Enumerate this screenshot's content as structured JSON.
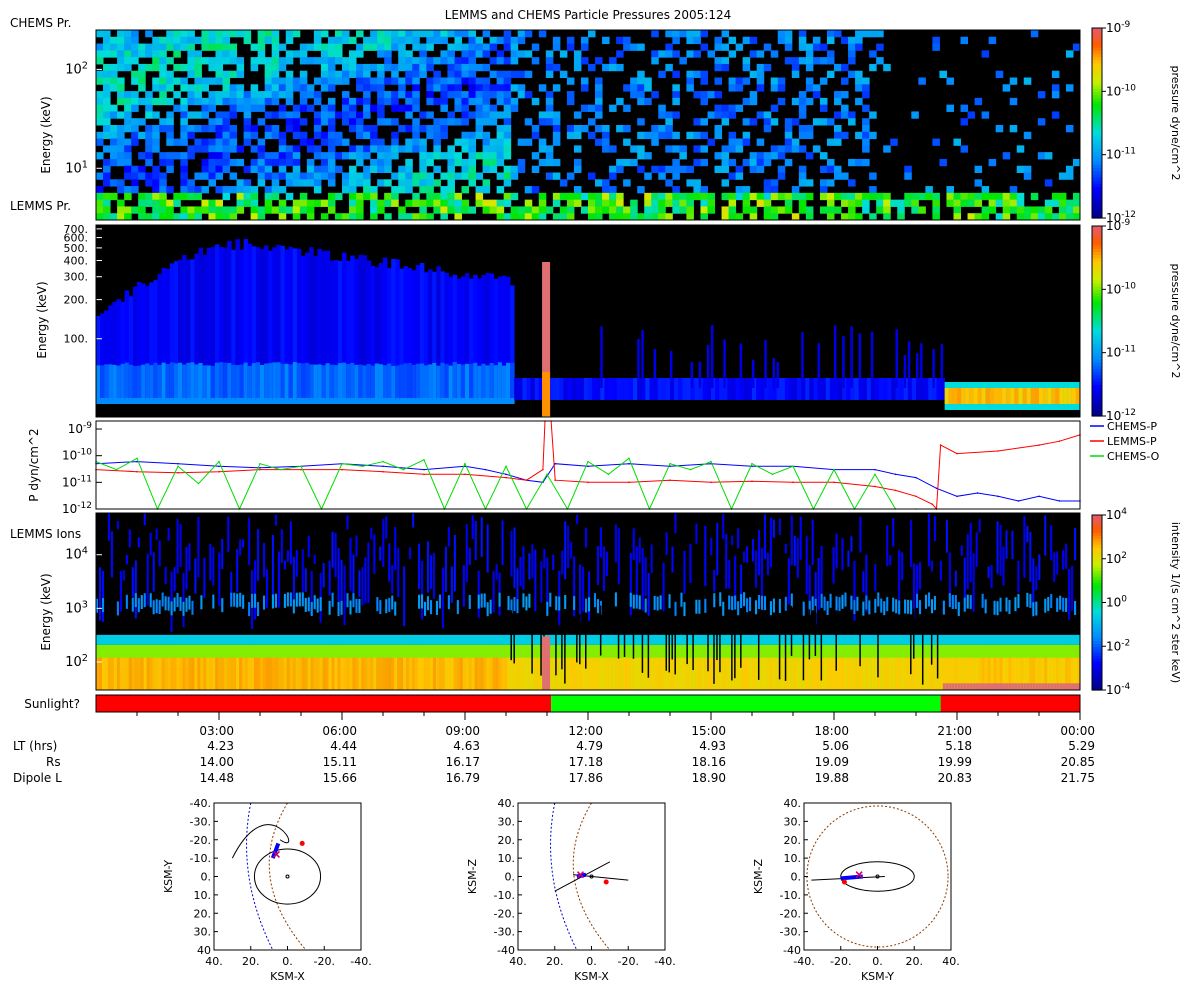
{
  "title": "LEMMS and CHEMS Particle Pressures  2005:124",
  "chart_data": [
    {
      "type": "heatmap",
      "label": "CHEMS Pr.",
      "ylabel": "Energy (keV)",
      "y_scale": "log",
      "ylim": [
        3,
        250
      ],
      "y_ticks": [
        {
          "v": 10,
          "label": "10^1"
        },
        {
          "v": 100,
          "label": "10^2"
        }
      ],
      "colorbar": {
        "label": "pressure dyne/cm^2",
        "scale": "log",
        "range": [
          1e-12,
          1e-09
        ],
        "ticks": [
          "10^-9",
          "10^-10",
          "10^-11",
          "10^-12"
        ]
      }
    },
    {
      "type": "heatmap",
      "label": "LEMMS Pr.",
      "ylabel": "Energy (keV)",
      "y_scale": "log",
      "ylim": [
        25,
        750
      ],
      "y_ticks": [
        "100.",
        "200.",
        "300.",
        "400.",
        "500.",
        "600.",
        "700."
      ],
      "colorbar": {
        "label": "pressure dyne/cm^2",
        "scale": "log",
        "range": [
          1e-12,
          1e-09
        ],
        "ticks": [
          "10^-9",
          "10^-10",
          "10^-11",
          "10^-12"
        ]
      }
    },
    {
      "type": "line",
      "ylabel": "P dyn/cm^2",
      "y_scale": "log",
      "ylim": [
        1e-12,
        2e-09
      ],
      "y_ticks": [
        "10^-9",
        "10^-10",
        "10^-11",
        "10^-12"
      ],
      "x_unit": "hours UT",
      "series": [
        {
          "name": "CHEMS-P",
          "color": "#0000ff",
          "x": [
            0,
            1,
            2,
            3,
            4,
            5,
            6,
            7,
            8,
            9,
            9.5,
            10,
            10.5,
            10.9,
            11.2,
            12,
            13,
            14,
            15,
            16,
            17,
            18,
            19,
            19.5,
            20,
            20.5,
            21,
            21.5,
            22,
            22.5,
            23,
            23.5,
            24
          ],
          "y": [
            5e-11,
            6e-11,
            5e-11,
            4e-11,
            3.5e-11,
            4e-11,
            5e-11,
            4e-11,
            3e-11,
            4e-11,
            3e-11,
            2e-11,
            1.2e-11,
            1e-11,
            5e-11,
            4e-11,
            5e-11,
            4e-11,
            5e-11,
            4e-11,
            4e-11,
            3e-11,
            3e-11,
            2e-11,
            1.5e-11,
            6e-12,
            3e-12,
            4e-12,
            3e-12,
            2e-12,
            3e-12,
            2e-12,
            2e-12
          ]
        },
        {
          "name": "LEMMS-P",
          "color": "#ff0000",
          "x": [
            0,
            1,
            2,
            3,
            4,
            5,
            6,
            7,
            8,
            9,
            10,
            10.5,
            10.9,
            10.95,
            11.1,
            11.2,
            12,
            13,
            14,
            15,
            16,
            17,
            18,
            19,
            19.5,
            20,
            20.4,
            20.5,
            20.6,
            21,
            22,
            23,
            23.5,
            24
          ],
          "y": [
            3e-11,
            2.5e-11,
            2.3e-11,
            2.5e-11,
            3e-11,
            3e-11,
            3e-11,
            2.5e-11,
            2e-11,
            2e-11,
            1.5e-11,
            1.2e-11,
            3e-11,
            2e-09,
            2e-09,
            1.2e-11,
            1e-11,
            1e-11,
            1.2e-11,
            1e-11,
            1.1e-11,
            1e-11,
            1e-11,
            7e-12,
            5e-12,
            3e-12,
            1.5e-12,
            1e-12,
            2.5e-10,
            1.2e-10,
            1.5e-10,
            2.5e-10,
            3.5e-10,
            6e-10
          ]
        },
        {
          "name": "CHEMS-O",
          "color": "#00dd00",
          "x": [
            0,
            0.5,
            1,
            1.5,
            2,
            2.5,
            3,
            3.5,
            4,
            4.5,
            5,
            5.5,
            6,
            6.5,
            7,
            7.5,
            8,
            8.5,
            9,
            9.5,
            10,
            10.5,
            11,
            11.5,
            12,
            12.5,
            13,
            13.5,
            14,
            14.5,
            15,
            15.5,
            16,
            16.5,
            17,
            17.5,
            18,
            18.5,
            19,
            19.5,
            20
          ],
          "y": [
            6e-11,
            3e-11,
            8e-11,
            1e-12,
            4e-11,
            9e-12,
            6e-11,
            1e-12,
            5e-11,
            3e-11,
            4e-11,
            1e-12,
            5e-11,
            4e-11,
            6e-11,
            3e-11,
            7e-11,
            1e-12,
            5e-11,
            1e-12,
            4e-11,
            1e-12,
            2e-11,
            1e-12,
            6e-11,
            2e-11,
            8e-11,
            1e-12,
            5e-11,
            3e-11,
            6e-11,
            1e-12,
            5e-11,
            2e-11,
            4e-11,
            1e-12,
            3e-11,
            1e-12,
            2e-11,
            1e-12,
            1e-12
          ]
        }
      ]
    },
    {
      "type": "heatmap",
      "label": "LEMMS Ions",
      "ylabel": "Energy (keV)",
      "y_scale": "log",
      "ylim": [
        30,
        60000
      ],
      "y_ticks": [
        {
          "v": 100,
          "label": "10^2"
        },
        {
          "v": 1000,
          "label": "10^3"
        },
        {
          "v": 10000,
          "label": "10^4"
        }
      ],
      "colorbar": {
        "label": "intensity 1/(s cm^2 ster keV)",
        "scale": "log",
        "range": [
          1e-05,
          10000.0
        ],
        "ticks": [
          "10^4",
          "10^2",
          "10^0",
          "10^-2",
          "10^-4"
        ]
      }
    },
    {
      "type": "bar",
      "label": "Sunlight?",
      "segments": [
        {
          "start": 0,
          "end": 11.1,
          "color": "#ff0000"
        },
        {
          "start": 11.1,
          "end": 20.6,
          "color": "#00ff00"
        },
        {
          "start": 20.6,
          "end": 24,
          "color": "#ff0000"
        }
      ]
    }
  ],
  "x_axis": {
    "ticks": [
      "03:00",
      "06:00",
      "09:00",
      "12:00",
      "15:00",
      "18:00",
      "21:00",
      "00:00"
    ],
    "rows": [
      {
        "label": "LT (hrs)",
        "values": [
          "4.23",
          "4.44",
          "4.63",
          "4.79",
          "4.93",
          "5.06",
          "5.18",
          "5.29"
        ]
      },
      {
        "label": "Rs",
        "values": [
          "14.00",
          "15.11",
          "16.17",
          "17.18",
          "18.16",
          "19.09",
          "19.99",
          "20.85"
        ]
      },
      {
        "label": "Dipole L",
        "values": [
          "14.48",
          "15.66",
          "16.79",
          "17.86",
          "18.90",
          "19.88",
          "20.83",
          "21.75"
        ]
      }
    ]
  },
  "orbit_plots": [
    {
      "xlabel": "KSM-X",
      "ylabel": "KSM-Y",
      "x_ticks": [
        "40.",
        "20.",
        "0.",
        "-20.",
        "-40."
      ],
      "y_ticks": [
        "-40.",
        "-30.",
        "-20.",
        "-10.",
        "0.",
        "10.",
        "20.",
        "30.",
        "40"
      ]
    },
    {
      "xlabel": "KSM-X",
      "ylabel": "KSM-Z",
      "x_ticks": [
        "40.",
        "20.",
        "0.",
        "-20.",
        "-40."
      ],
      "y_ticks": [
        "40.",
        "30.",
        "20.",
        "10.",
        "0.",
        "-10.",
        "-20.",
        "-30.",
        "-40"
      ]
    },
    {
      "xlabel": "KSM-Y",
      "ylabel": "KSM-Z",
      "x_ticks": [
        "-40.",
        "-20.",
        "0.",
        "20.",
        "40."
      ],
      "y_ticks": [
        "40.",
        "30.",
        "20.",
        "10.",
        "0.",
        "-10.",
        "-20.",
        "-30.",
        "-40"
      ]
    }
  ]
}
